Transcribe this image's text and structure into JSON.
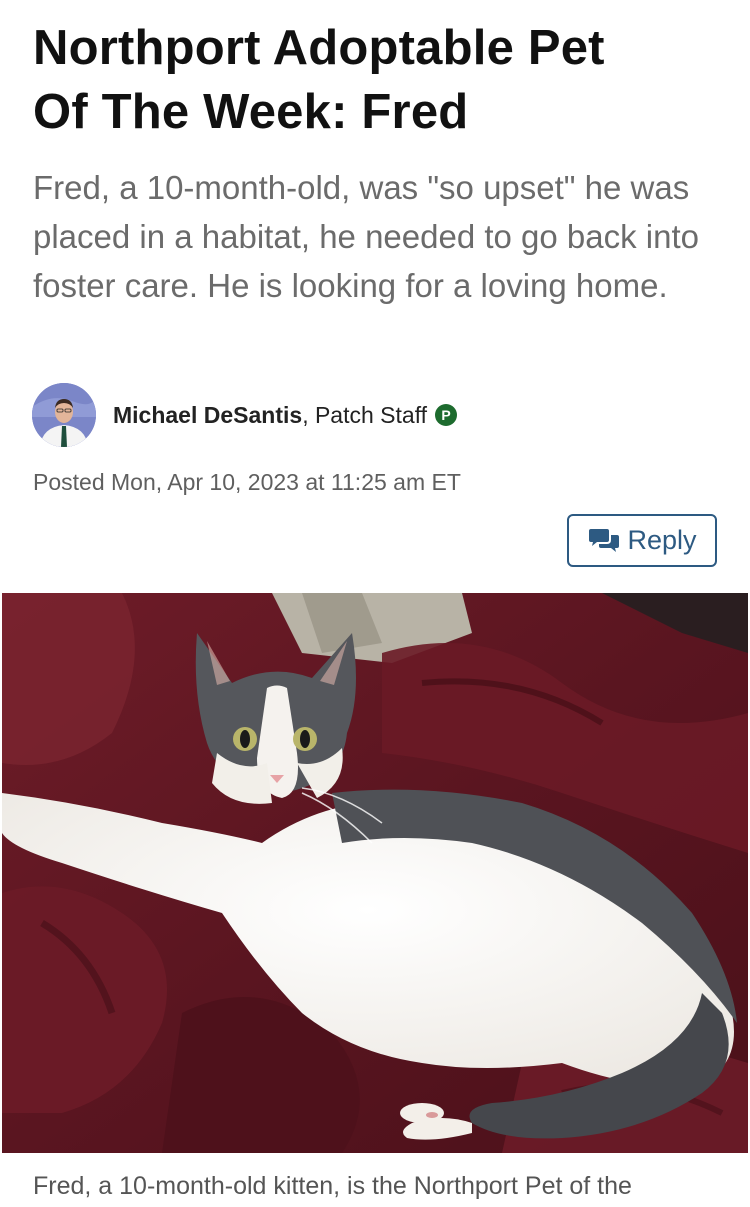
{
  "article": {
    "title_line1": "Northport Adoptable Pet",
    "title_line2": "Of The Week: Fred",
    "dek": "Fred, a 10-month-old, was \"so upset\" he was placed in a habitat, he needed to go back into foster care. He is looking for a loving home.",
    "author": {
      "name": "Michael DeSantis",
      "role": ", Patch Staff",
      "badge_letter": "P"
    },
    "posted": "Posted Mon, Apr 10, 2023 at 11:25 am ET",
    "reply_label": "Reply",
    "caption": "Fred, a 10-month-old kitten, is the Northport Pet of the"
  },
  "icons": {
    "reply": "chat-bubbles-icon",
    "badge": "patch-badge-icon"
  },
  "colors": {
    "accent": "#2d5a82",
    "badge_green": "#1d6b2e",
    "dek_gray": "#6b6b6b",
    "blanket": "#5a1520"
  }
}
